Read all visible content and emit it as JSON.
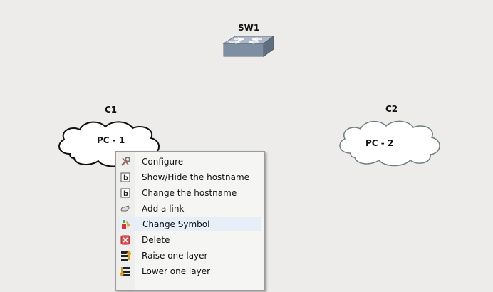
{
  "nodes": {
    "sw1": {
      "label": "SW1"
    },
    "c1": {
      "label": "C1",
      "text": "PC - 1"
    },
    "c2": {
      "label": "C2",
      "text": "PC - 2"
    }
  },
  "context_menu": {
    "items": [
      {
        "label": "Configure",
        "icon": "wrench-icon"
      },
      {
        "label": "Show/Hide the hostname",
        "icon": "hostname-toggle-icon"
      },
      {
        "label": "Change the hostname",
        "icon": "hostname-edit-icon"
      },
      {
        "label": "Add a link",
        "icon": "link-icon"
      },
      {
        "label": "Change Symbol",
        "icon": "symbol-icon",
        "highlighted": true
      },
      {
        "label": "Delete",
        "icon": "delete-icon"
      },
      {
        "label": "Raise one layer",
        "icon": "raise-layer-icon"
      },
      {
        "label": "Lower one layer",
        "icon": "lower-layer-icon"
      }
    ]
  }
}
